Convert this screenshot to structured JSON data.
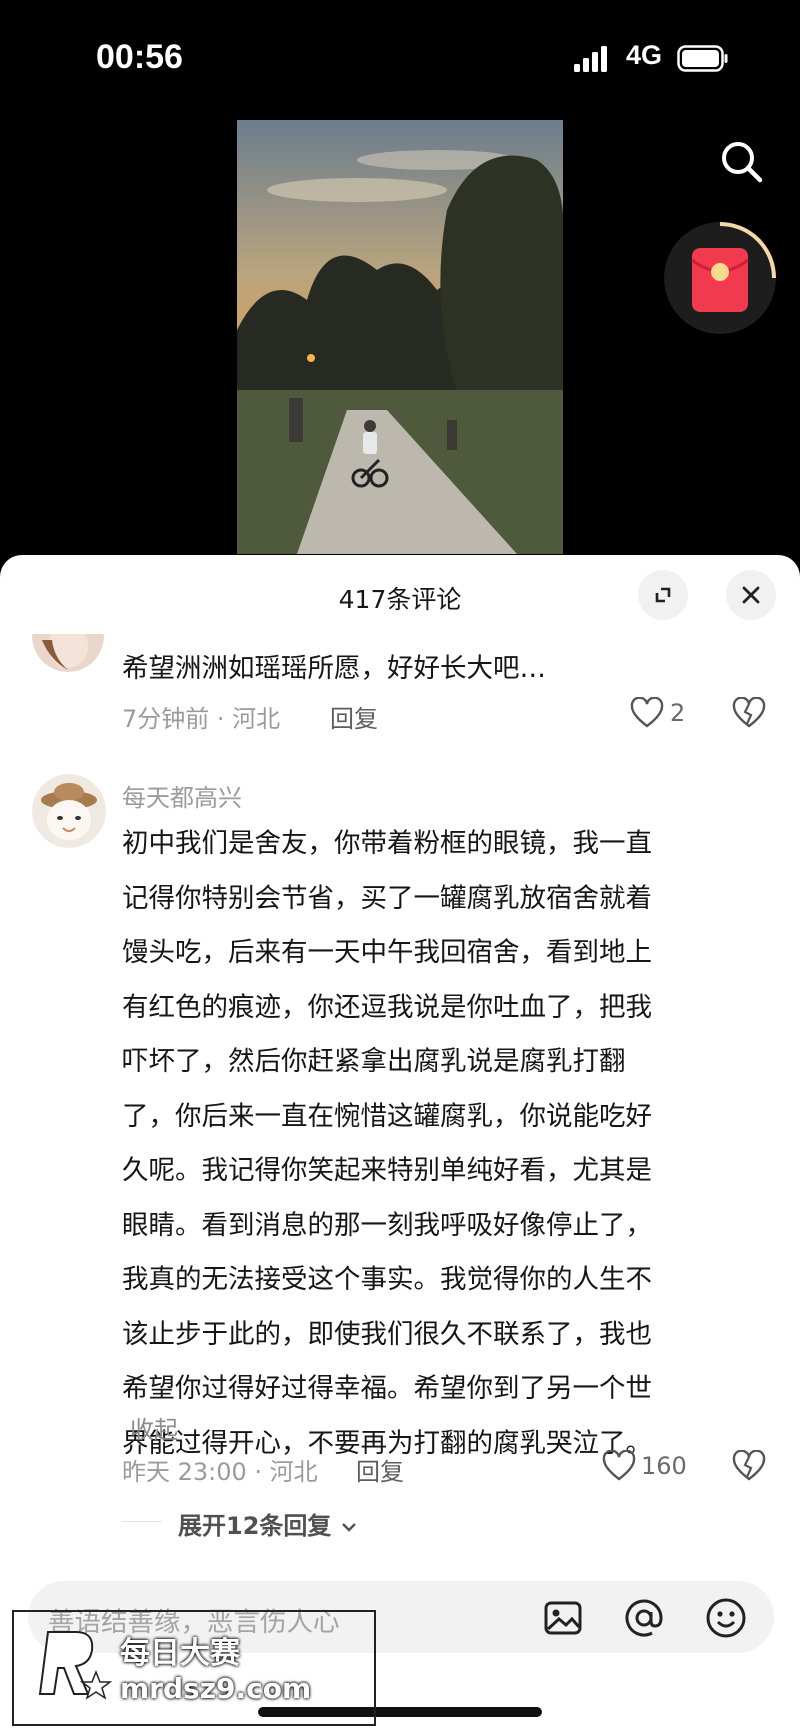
{
  "status": {
    "time": "00:56",
    "network": "4G"
  },
  "sheet": {
    "title": "417条评论"
  },
  "comments": [
    {
      "text": "希望洲洲如瑶瑶所愿，好好长大吧…",
      "meta": "7分钟前 · 河北",
      "reply_label": "回复",
      "likes": "2"
    },
    {
      "username": "每天都高兴",
      "lines": [
        "初中我们是舍友，你带着粉框的眼镜，我一直",
        "记得你特别会节省，买了一罐腐乳放宿舍就着",
        "馒头吃，后来有一天中午我回宿舍，看到地上",
        "有红色的痕迹，你还逗我说是你吐血了，把我",
        "吓坏了，然后你赶紧拿出腐乳说是腐乳打翻",
        "了，你后来一直在惋惜这罐腐乳，你说能吃好",
        "久呢。我记得你笑起来特别单纯好看，尤其是",
        "眼睛。看到消息的那一刻我呼吸好像停止了，",
        "我真的无法接受这个事实。我觉得你的人生不",
        "该止步于此的，即使我们很久不联系了，我也",
        "希望你过得好过得幸福。希望你到了另一个世",
        "界能过得开心，不要再为打翻的腐乳哭泣了。"
      ],
      "collapse_label": "收起",
      "meta": "昨天 23:00 · 河北",
      "reply_label": "回复",
      "likes": "160",
      "expand_label": "展开12条回复"
    }
  ],
  "input": {
    "placeholder": "善语结善缘，恶言伤人心"
  },
  "watermark": {
    "line1": "每日大赛",
    "line2": "mrdsz9.com"
  },
  "icons": [
    "search-icon",
    "red-packet-icon",
    "expand-icon",
    "close-icon",
    "heart-icon",
    "dislike-icon",
    "chevron-down-icon",
    "image-icon",
    "at-icon",
    "emoji-icon"
  ]
}
